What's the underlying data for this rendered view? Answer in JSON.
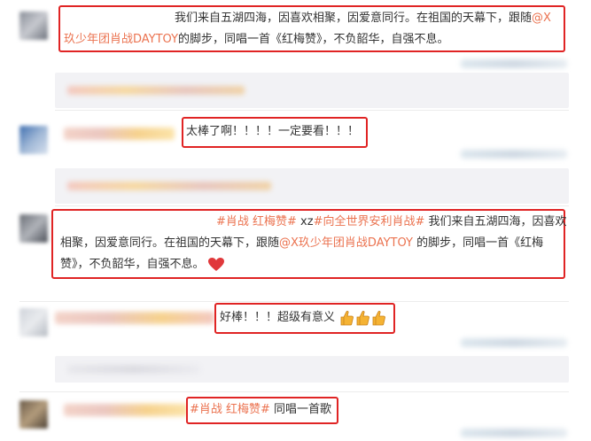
{
  "comments": [
    {
      "text_line1": "我们来自五湖四海，因喜欢相聚，因爱意同行。在祖国的天幕下，跟随",
      "mention_part1": "@X",
      "mention_part2": "玖少年团肖战DAYTOY",
      "text_line2_rest": "的脚步，同唱一首《红梅赞》，不负韶华，自强不息。"
    },
    {
      "text": "太棒了啊！！！！一定要看！！！"
    },
    {
      "topic1": "#肖战 红梅赞#",
      "joiner": " xz",
      "topic2": "#向全世界安利肖战#",
      "text_line1_rest": " 我们来自五湖四海，因喜欢",
      "text_line2_a": "相聚，因爱意同行。在祖国的天幕下，跟随",
      "mention": "@X玖少年团肖战DAYTOY",
      "text_line2_b": " 的脚步，同唱一首《红梅",
      "text_line3": "赞》，不负韶华，自强不息。",
      "emoji": "heart-emoji"
    },
    {
      "text": "好棒！！！超级有意义",
      "emoji": "thumbs-up-emoji"
    },
    {
      "topic": "#肖战 红梅赞#",
      "text": " 同唱一首歌"
    }
  ],
  "colors": {
    "highlight_border": "#e02424",
    "link": "#eb7350",
    "reply_background": "#f2f2f5"
  }
}
